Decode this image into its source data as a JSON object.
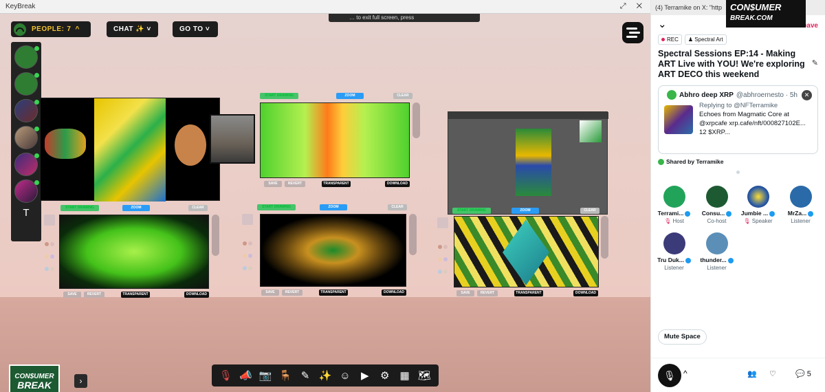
{
  "window": {
    "title": "KeyBreak",
    "controls": "⤢ ✕",
    "banner_text": "… to exit full screen, press"
  },
  "toolbar": {
    "people_label": "PEOPLE:",
    "people_count": "7",
    "people_caret": "^",
    "chat_label": "CHAT ✨ ˅",
    "goto_label": "GO TO ˅"
  },
  "sidebar": {
    "text_avatar": "T"
  },
  "board": {
    "start_drawing": "START DRAWING",
    "zoom": "ZOOM",
    "clear": "CLEAR",
    "save": "SAVE",
    "revert": "REVERT",
    "transparent": "TRANSPARENT",
    "download": "DOWNLOAD"
  },
  "logo": {
    "line1": "CON$UMER",
    "line2": "BREAK"
  },
  "bottom_bar": {
    "icons": [
      "mic-off-icon",
      "megaphone-icon",
      "camera-icon",
      "seat-icon",
      "pen-icon",
      "sparkle-icon",
      "emoji-icon",
      "play-icon",
      "settings-icon",
      "grid-icon",
      "map-icon"
    ]
  },
  "browser": {
    "tab_title": "(4) Terramike on X: \"http",
    "overlay_line1": "CON$UMER",
    "overlay_line2": "BREAK.COM"
  },
  "space": {
    "leave_label": "Leave",
    "tag_rec": "REC",
    "tag_topic": "Spectral Art",
    "title": "Spectral Sessions EP:14 - Making ART Live with YOU!  We're exploring ART DECO this weekend",
    "post": {
      "author": "Abhro deep XRP",
      "handle": "@abhroernesto · 5h",
      "replying_to": "Replying to @NFTerramike",
      "text": "Echoes from Magmatic Core at @xrpcafe xrp.cafe/nft/000827102E...",
      "price": "12 $XRP..."
    },
    "shared_by": "Shared by Terramike",
    "speakers": [
      {
        "name": "Terrami...",
        "role": "Host",
        "color": "#22a35a"
      },
      {
        "name": "Consu...",
        "role": "Co-host",
        "color": "#1d5a32"
      },
      {
        "name": "Jumbie ...",
        "role": "Speaker",
        "color": "#2a5ca8"
      },
      {
        "name": "MrZa...",
        "role": "Listener",
        "color": "#2a6aa8"
      },
      {
        "name": "Tru Duk...",
        "role": "Listener",
        "color": "#3b3b7a"
      },
      {
        "name": "thunder...",
        "role": "Listener",
        "color": "#5b8fb8"
      }
    ],
    "mute_label": "Mute Space",
    "reply_count": "5"
  }
}
